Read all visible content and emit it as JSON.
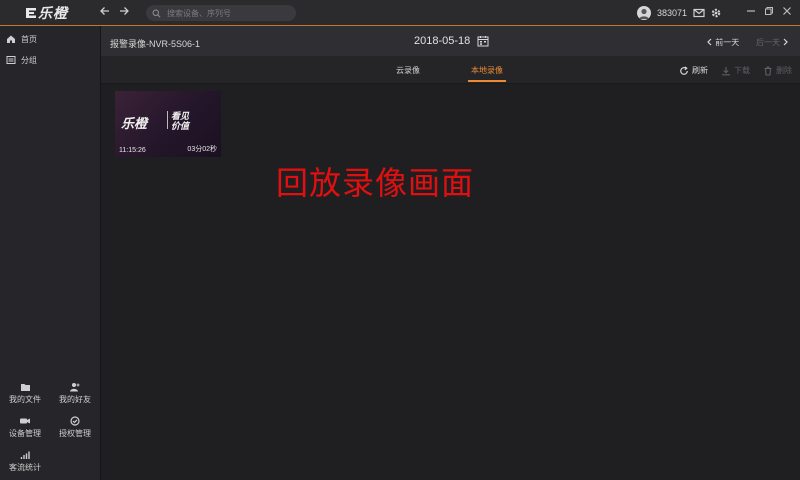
{
  "app": {
    "logo_text": "乐橙"
  },
  "titlebar": {
    "search_placeholder": "搜索设备、序列号",
    "user_id": "383071"
  },
  "sidebar": {
    "top_items": [
      {
        "label": "首页",
        "icon": "home-icon"
      },
      {
        "label": "分组",
        "icon": "group-icon"
      }
    ],
    "bottom_items": [
      {
        "label": "我的文件",
        "icon": "folder-icon"
      },
      {
        "label": "我的好友",
        "icon": "friends-icon"
      },
      {
        "label": "设备管理",
        "icon": "device-icon"
      },
      {
        "label": "授权管理",
        "icon": "authorize-icon"
      },
      {
        "label": "客流统计",
        "icon": "stats-icon"
      }
    ]
  },
  "subheader": {
    "breadcrumb": "报警录像-NVR-5S06-1",
    "date": "2018-05-18",
    "prev_day": "前一天",
    "next_day": "后一天"
  },
  "tabs": {
    "cloud": "云录像",
    "local": "本地录像",
    "active": "local"
  },
  "actions": {
    "refresh": "刷新",
    "download": "下载",
    "delete": "删除"
  },
  "recordings": [
    {
      "time": "11:15:26",
      "duration": "03分02秒",
      "logo": "乐橙",
      "slogan_line1": "看见",
      "slogan_line2": "价值"
    }
  ],
  "overlay": {
    "text": "回放录像画面"
  },
  "colors": {
    "accent": "#ea8a32",
    "overlay_text": "#e01010"
  }
}
